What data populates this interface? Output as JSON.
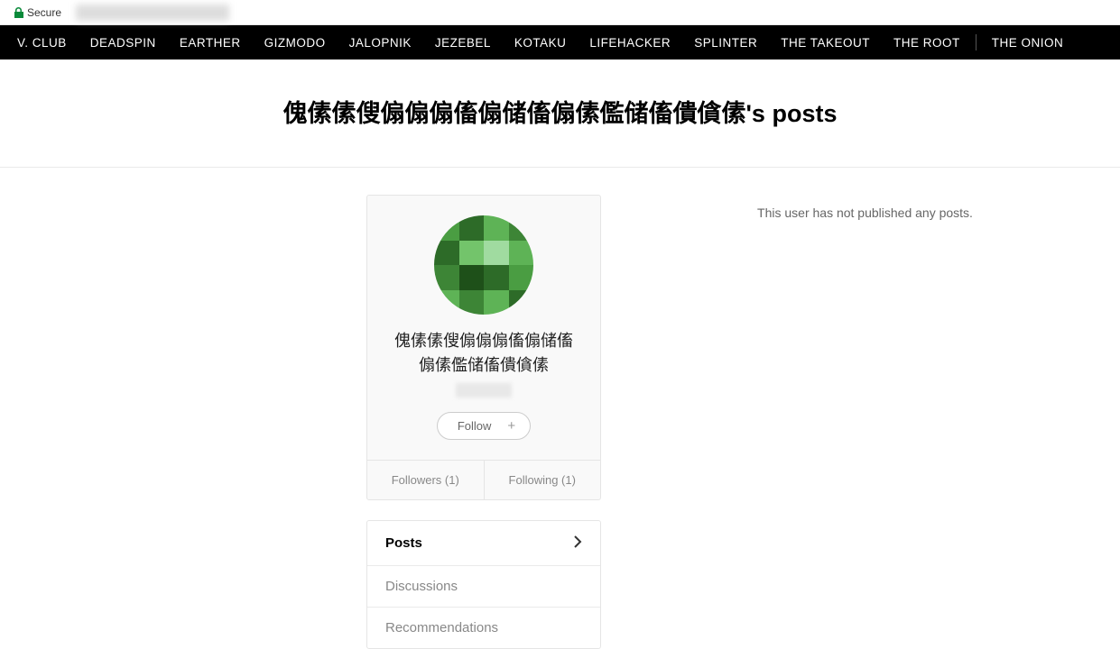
{
  "browser": {
    "secure_label": "Secure"
  },
  "nav": {
    "items": [
      "V. CLUB",
      "DEADSPIN",
      "EARTHER",
      "GIZMODO",
      "JALOPNIK",
      "JEZEBEL",
      "KOTAKU",
      "LIFEHACKER",
      "SPLINTER",
      "THE TAKEOUT",
      "THE ROOT"
    ],
    "extra": "THE ONION"
  },
  "page": {
    "title": "傀傃傃傁傓傓傓傗傓储傗傓傃儖储傗僓僋傃's posts"
  },
  "profile": {
    "name": "傀傃傃傁傓傓傓傗傓储傗傓傃儖储傗僓僋傃",
    "follow_label": "Follow",
    "followers_label": "Followers (1)",
    "following_label": "Following (1)",
    "avatar_colors": [
      "#4a9d42",
      "#2d6b28",
      "#5eb356",
      "#3d8536",
      "#2d6b28",
      "#73c46b",
      "#a0dba0",
      "#5eb356",
      "#3d8536",
      "#1e5019",
      "#2d6b28",
      "#4a9d42",
      "#5eb356",
      "#3d8536",
      "#5eb356",
      "#2d6b28"
    ]
  },
  "tabs": {
    "items": [
      "Posts",
      "Discussions",
      "Recommendations"
    ],
    "active_index": 0
  },
  "content": {
    "empty_message": "This user has not published any posts."
  }
}
